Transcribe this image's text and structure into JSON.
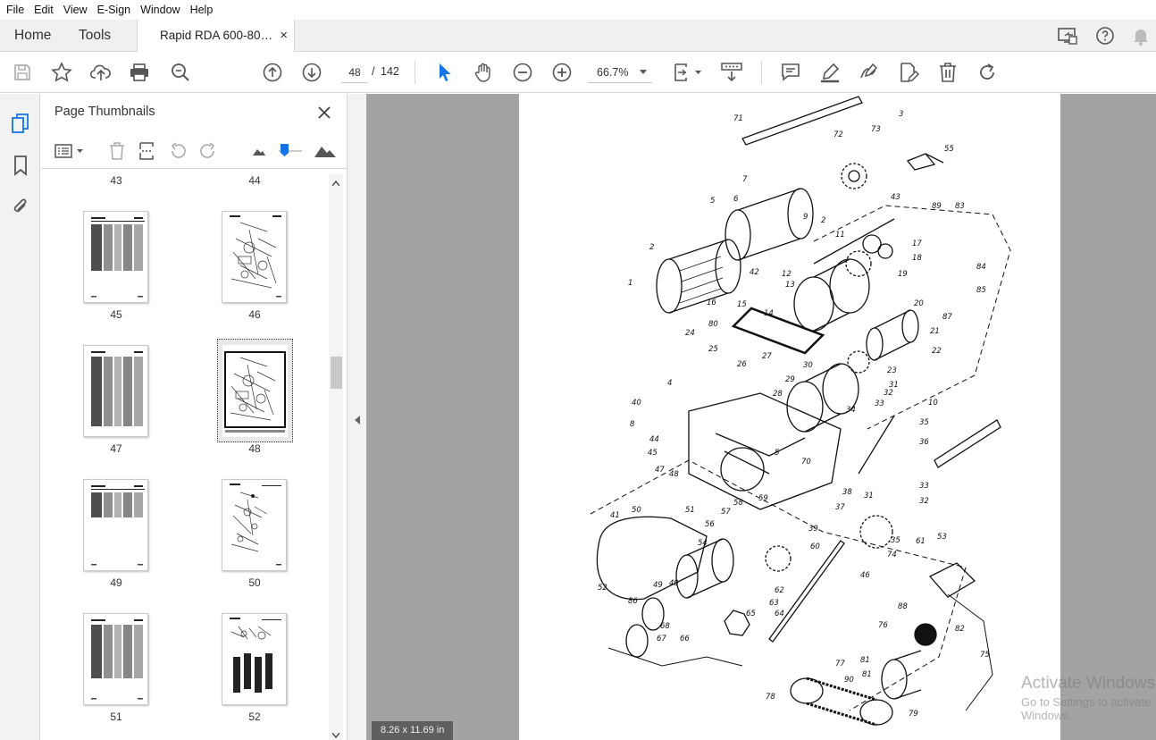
{
  "menu": [
    "File",
    "Edit",
    "View",
    "E-Sign",
    "Window",
    "Help"
  ],
  "tabs": {
    "home": "Home",
    "tools": "Tools",
    "document": "Rapid RDA 600-80…",
    "close": "×"
  },
  "toolbar": {
    "current_page": "48",
    "page_separator": "/",
    "total_pages": "142",
    "zoom": "66.7%"
  },
  "panel": {
    "title": "Page Thumbnails",
    "thumbnails": [
      {
        "page": "43"
      },
      {
        "page": "44"
      },
      {
        "page": "45",
        "kind": "table"
      },
      {
        "page": "46",
        "kind": "diagram"
      },
      {
        "page": "47",
        "kind": "table"
      },
      {
        "page": "48",
        "kind": "diagram",
        "selected": true
      },
      {
        "page": "49",
        "kind": "table"
      },
      {
        "page": "50",
        "kind": "diagram"
      },
      {
        "page": "51",
        "kind": "table"
      },
      {
        "page": "52",
        "kind": "diagram"
      }
    ]
  },
  "document": {
    "page_size": "8.26 x 11.69 in",
    "part_labels": [
      "71",
      "3",
      "72",
      "73",
      "55",
      "43",
      "7",
      "5",
      "6",
      "9",
      "2",
      "89",
      "83",
      "11",
      "17",
      "18",
      "19",
      "1",
      "2",
      "42",
      "12",
      "13",
      "16",
      "15",
      "84",
      "85",
      "20",
      "87",
      "80",
      "14",
      "21",
      "22",
      "24",
      "25",
      "26",
      "27",
      "30",
      "23",
      "29",
      "4",
      "28",
      "31",
      "32",
      "33",
      "35",
      "36",
      "10",
      "40",
      "8",
      "34",
      "44",
      "45",
      "70",
      "47",
      "48",
      "5",
      "38",
      "50",
      "51",
      "58",
      "59",
      "33",
      "32",
      "31",
      "37",
      "41",
      "57",
      "56",
      "39",
      "54",
      "60",
      "61",
      "35",
      "53",
      "74",
      "49",
      "46",
      "52",
      "62",
      "63",
      "64",
      "86",
      "49",
      "65",
      "68",
      "88",
      "67",
      "66",
      "76",
      "81",
      "82",
      "75",
      "77",
      "81",
      "90",
      "78",
      "79"
    ]
  },
  "watermark": {
    "line1": "Activate Windows",
    "line2": "Go to Settings to activate Windows."
  }
}
